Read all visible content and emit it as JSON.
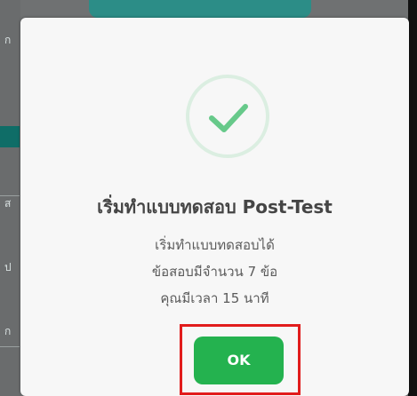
{
  "modal": {
    "title": "เริ่มทำแบบทดสอบ Post-Test",
    "message_lines": [
      "เริ่มทำแบบทดสอบได้",
      "ข้อสอบมีจำนวน 7 ข้อ",
      "คุณมีเวลา 15 นาที"
    ],
    "ok_label": "OK",
    "icon": "success-check-icon"
  },
  "background": {
    "left_marks": [
      "ก",
      "ส",
      "ป",
      "ก"
    ]
  },
  "colors": {
    "accent_green": "#24b24f",
    "success_check": "#67c98a",
    "highlight_red": "#e11c1c",
    "teal": "#2c8d87"
  }
}
